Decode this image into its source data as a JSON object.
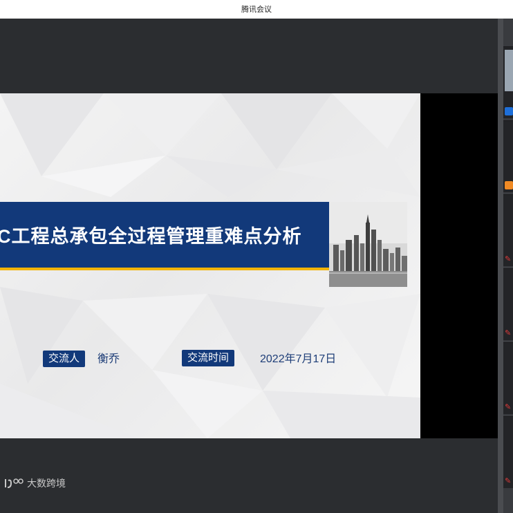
{
  "window": {
    "title": "腾讯会议"
  },
  "slide": {
    "title": "C工程总承包全过程管理重难点分析",
    "presenter_label": "交流人",
    "presenter_name": "衡乔",
    "time_label": "交流时间",
    "date": "2022年7月17日"
  },
  "watermark": {
    "text": "大数跨境"
  },
  "participants": [
    {
      "badge": "user-blue-icon",
      "color": "#1e6fd9"
    },
    {
      "badge": "user-orange-icon",
      "color": "#f08a24"
    },
    {
      "badge": "mic-muted-icon",
      "color": "#e03b3b"
    },
    {
      "badge": "mic-muted-icon",
      "color": "#e03b3b"
    },
    {
      "badge": "mic-muted-icon",
      "color": "#e03b3b"
    },
    {
      "badge": "mic-muted-icon",
      "color": "#e03b3b"
    }
  ]
}
